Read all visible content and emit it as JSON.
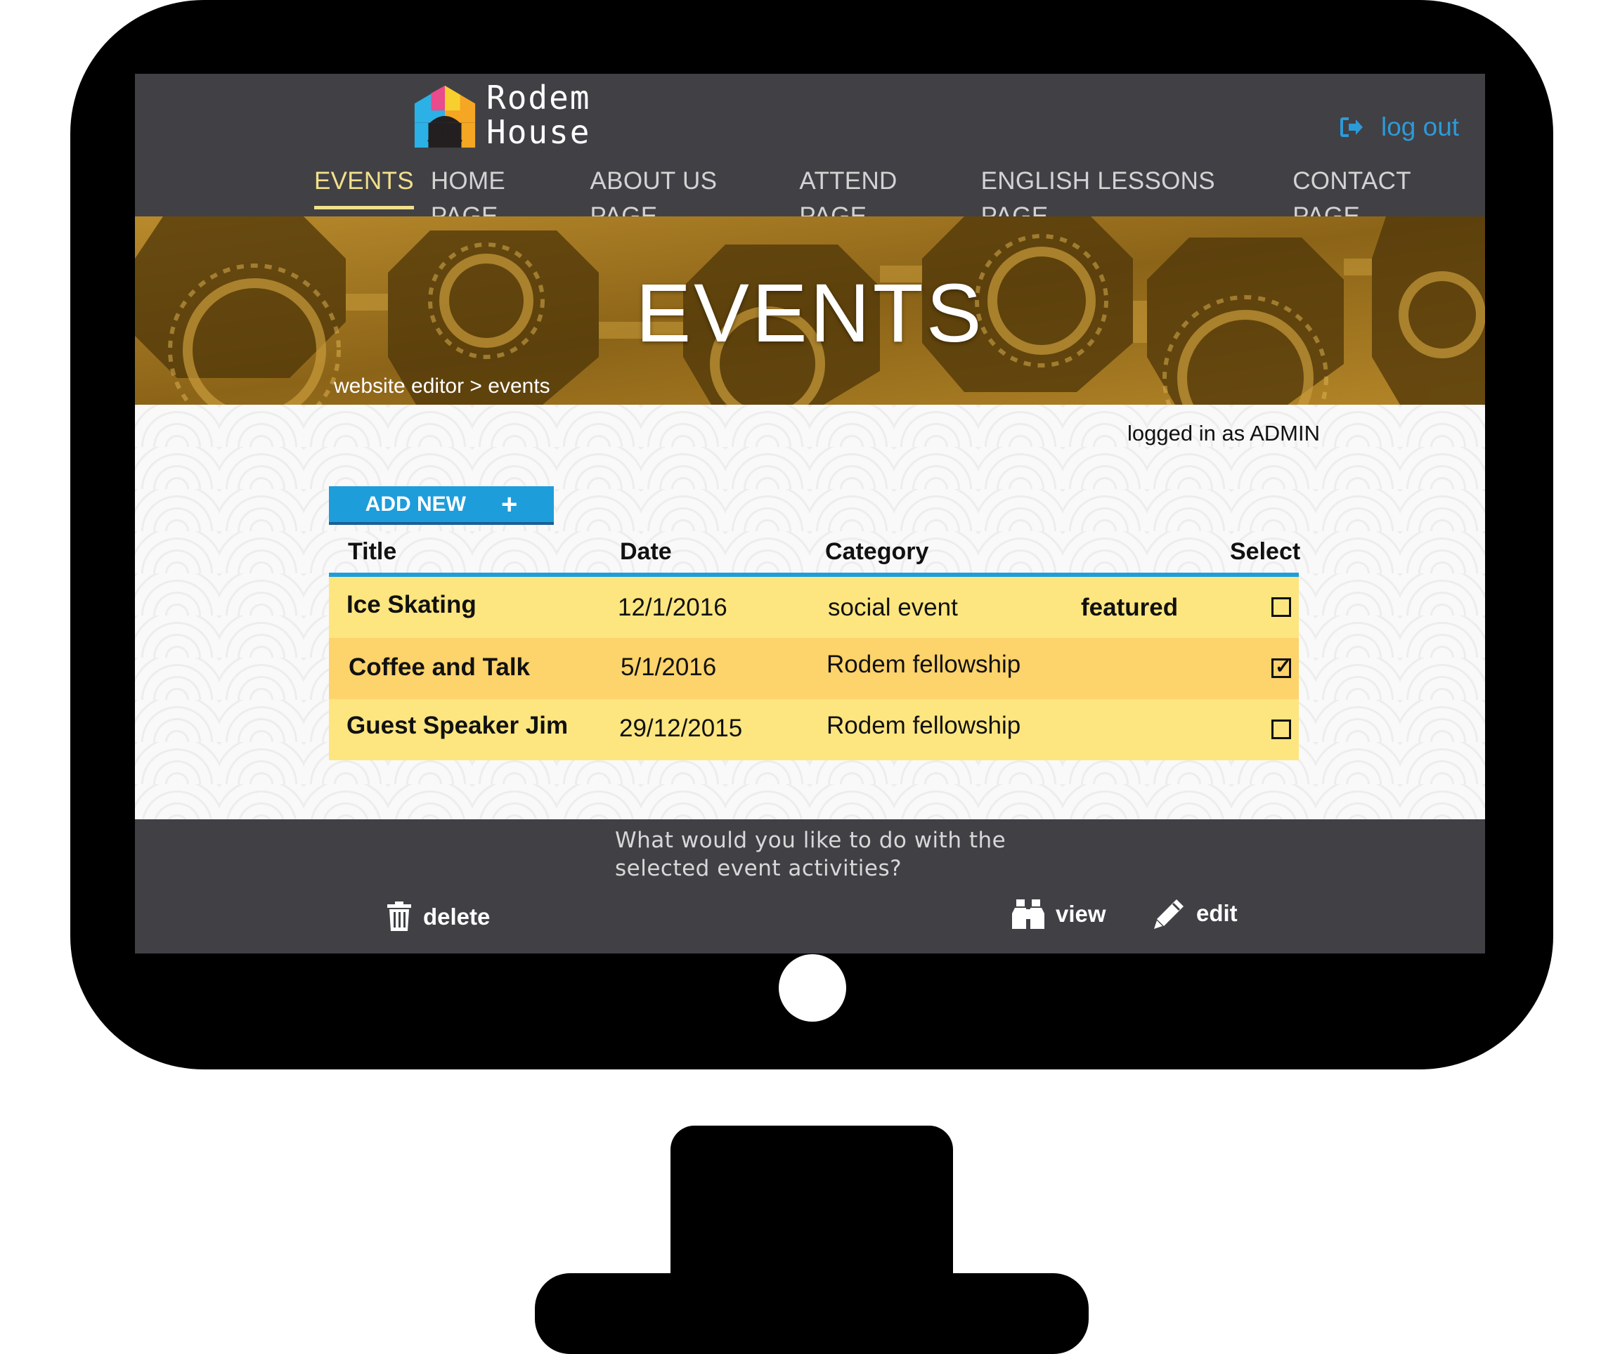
{
  "brand": {
    "line1": "Rodem",
    "line2": "House"
  },
  "header": {
    "logout_label": "log out"
  },
  "nav": [
    {
      "label": "EVENTS",
      "active": true
    },
    {
      "label": "HOME PAGE"
    },
    {
      "label": "ABOUT US PAGE"
    },
    {
      "label": "ATTEND PAGE"
    },
    {
      "label": "ENGLISH LESSONS PAGE"
    },
    {
      "label": "CONTACT PAGE"
    }
  ],
  "hero": {
    "title": "EVENTS",
    "breadcrumb": "website editor > events"
  },
  "main": {
    "logged_in": "logged in as ADMIN",
    "add_new_label": "ADD NEW",
    "add_new_icon": "+",
    "columns": [
      "Title",
      "Date",
      "Category",
      "Select"
    ],
    "rows": [
      {
        "title": "Ice Skating",
        "date": "12/1/2016",
        "category": "social event",
        "flag": "featured",
        "selected": false
      },
      {
        "title": "Coffee and Talk",
        "date": "5/1/2016",
        "category": "Rodem fellowship",
        "flag": "",
        "selected": true
      },
      {
        "title": "Guest Speaker Jim",
        "date": "29/12/2015",
        "category": "Rodem fellowship",
        "flag": "",
        "selected": false
      }
    ]
  },
  "footer": {
    "prompt": "What would you like to do with the selected event activities?",
    "delete_label": "delete",
    "view_label": "view",
    "edit_label": "edit"
  },
  "colors": {
    "header_bg": "#414045",
    "nav_active": "#f1e08c",
    "accent_blue": "#1e9ddb",
    "row_light": "#fde67f",
    "row_dark": "#fdd36b",
    "hero_gold": "#a77b22"
  },
  "icons": {
    "logout": "logout-icon",
    "delete": "trash-icon",
    "view": "binoculars-icon",
    "edit": "pencil-icon"
  }
}
